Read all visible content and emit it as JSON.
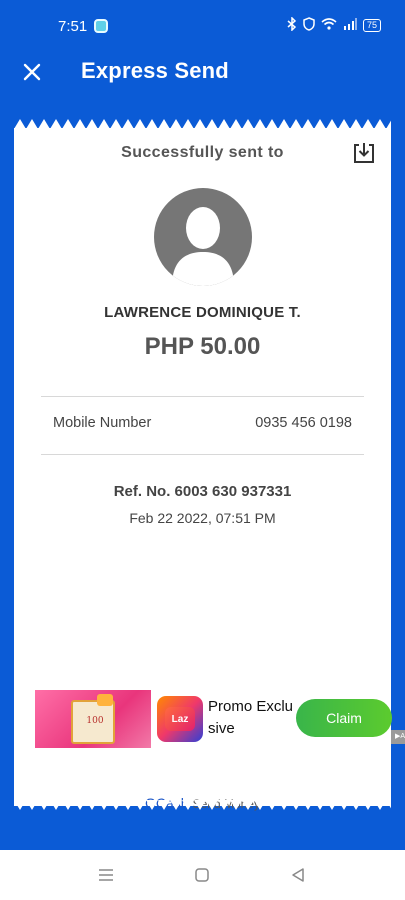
{
  "status_bar": {
    "time": "7:51",
    "battery": "75"
  },
  "header": {
    "title": "Express Send"
  },
  "receipt": {
    "heading": "Successfully sent to",
    "recipient_name": "LAWRENCE DOMINIQUE T.",
    "amount": "PHP 50.00",
    "mobile_label": "Mobile Number",
    "mobile_value": "0935 456 0198",
    "reference": "Ref. No. 6003 630 937331",
    "datetime": "Feb 22 2022, 07:51 PM"
  },
  "ad": {
    "text_line1": "Promo Exclu",
    "text_line2": "sive",
    "cta_label": "Claim",
    "logo_text": "Laz",
    "image_number": "100"
  },
  "footer": {
    "brand": "GCash",
    "service": "Send Money"
  },
  "colors": {
    "brand_blue": "#0b5bd6",
    "claim_green": "#39b54a",
    "avatar_gray": "#767676"
  },
  "icons": [
    "close-icon",
    "download-icon",
    "avatar-icon",
    "menu-icon",
    "home-icon",
    "back-icon",
    "bluetooth-icon",
    "wifi-icon",
    "signal-icon",
    "battery-icon"
  ]
}
